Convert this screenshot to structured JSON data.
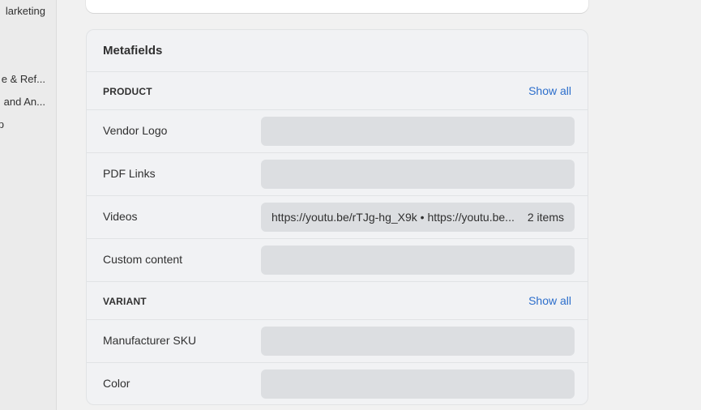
{
  "sidebar": {
    "items": [
      {
        "label": "larketing"
      },
      {
        "label": "e & Ref..."
      },
      {
        "label": "and An..."
      },
      {
        "label": "p"
      }
    ]
  },
  "metafields": {
    "title": "Metafields",
    "product": {
      "label": "PRODUCT",
      "show_all": "Show all",
      "rows": [
        {
          "label": "Vendor Logo",
          "value": "",
          "count": ""
        },
        {
          "label": "PDF Links",
          "value": "",
          "count": ""
        },
        {
          "label": "Videos",
          "value": "https://youtu.be/rTJg-hg_X9k • https://youtu.be...",
          "count": "2 items"
        },
        {
          "label": "Custom content",
          "value": "",
          "count": ""
        }
      ]
    },
    "variant": {
      "label": "VARIANT",
      "show_all": "Show all",
      "rows": [
        {
          "label": "Manufacturer SKU",
          "value": "",
          "count": ""
        },
        {
          "label": "Color",
          "value": "",
          "count": ""
        }
      ]
    }
  }
}
